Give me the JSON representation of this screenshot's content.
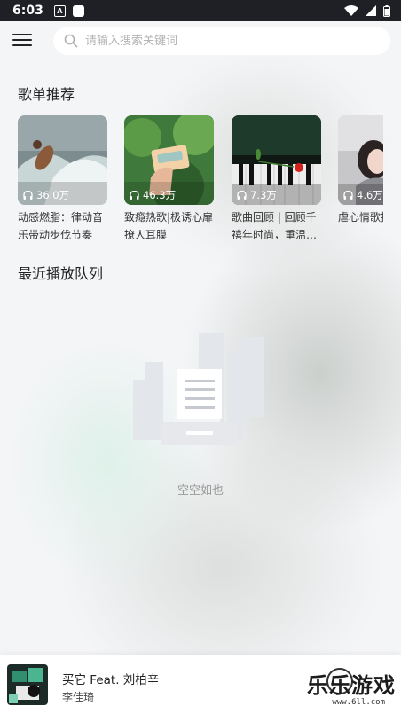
{
  "status_bar": {
    "time": "6:03",
    "notif_letter": "A"
  },
  "search": {
    "placeholder": "请输入搜索关键词"
  },
  "sections": {
    "playlist_title": "歌单推荐",
    "queue_title": "最近播放队列"
  },
  "playlists": [
    {
      "plays": "36.0万",
      "title": "动感燃脂：律动音乐带动步伐节奏"
    },
    {
      "plays": "46.3万",
      "title": "致瘾热歌|极诱心扉撩人耳膜"
    },
    {
      "plays": "7.3万",
      "title": "歌曲回顾 | 回顾千禧年时尚，重温…"
    },
    {
      "plays": "4.6万",
      "title": "虐心情歌接的爱却"
    }
  ],
  "queue": {
    "empty_text": "空空如也"
  },
  "player": {
    "song": "买它 Feat. 刘柏辛",
    "artist": "李佳琦"
  },
  "watermark": {
    "brand": "乐乐游戏",
    "url": "www.6ll.com"
  },
  "colors": {
    "status_bar": "#1f2026",
    "background": "#f4f5f7",
    "accent_text": "#222222"
  }
}
